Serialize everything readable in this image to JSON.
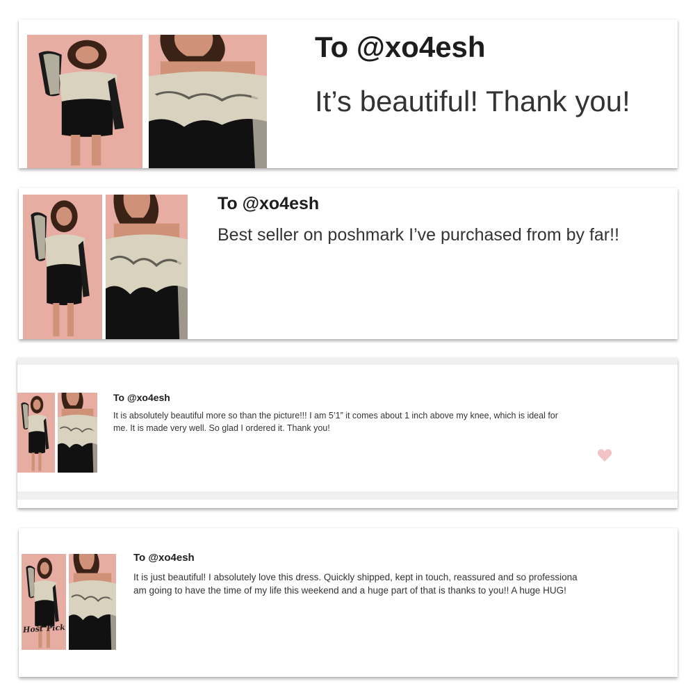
{
  "reviews": [
    {
      "to": "To @xo4esh",
      "lines": [
        "It’s beautiful! Thank you!"
      ]
    },
    {
      "to": "To @xo4esh",
      "lines": [
        "Best seller on poshmark I’ve purchased from by far!!"
      ]
    },
    {
      "to": "To @xo4esh",
      "lines": [
        "It is absolutely beautiful more so than the picture!!! I am 5’1” it comes about 1 inch above my knee, which is ideal for",
        "me. It is made very well. So glad I ordered it. Thank you!"
      ],
      "heart_icon": "heart-icon"
    },
    {
      "to": "To @xo4esh",
      "lines": [
        "It is just beautiful! I absolutely love this dress. Quickly shipped, kept in touch, reassured and so professiona",
        "am going to have the time of my life this weekend and a huge part of that is thanks to you!! A huge HUG!"
      ],
      "stamp_left": "Host",
      "stamp_right": "Pick"
    }
  ],
  "colors": {
    "photo_bg": "#e7ada2",
    "dress": "#111111",
    "lace": "#d9d2bf",
    "skin": "#cf9278",
    "hair": "#3a2216",
    "heart": "#f2c2c6"
  }
}
